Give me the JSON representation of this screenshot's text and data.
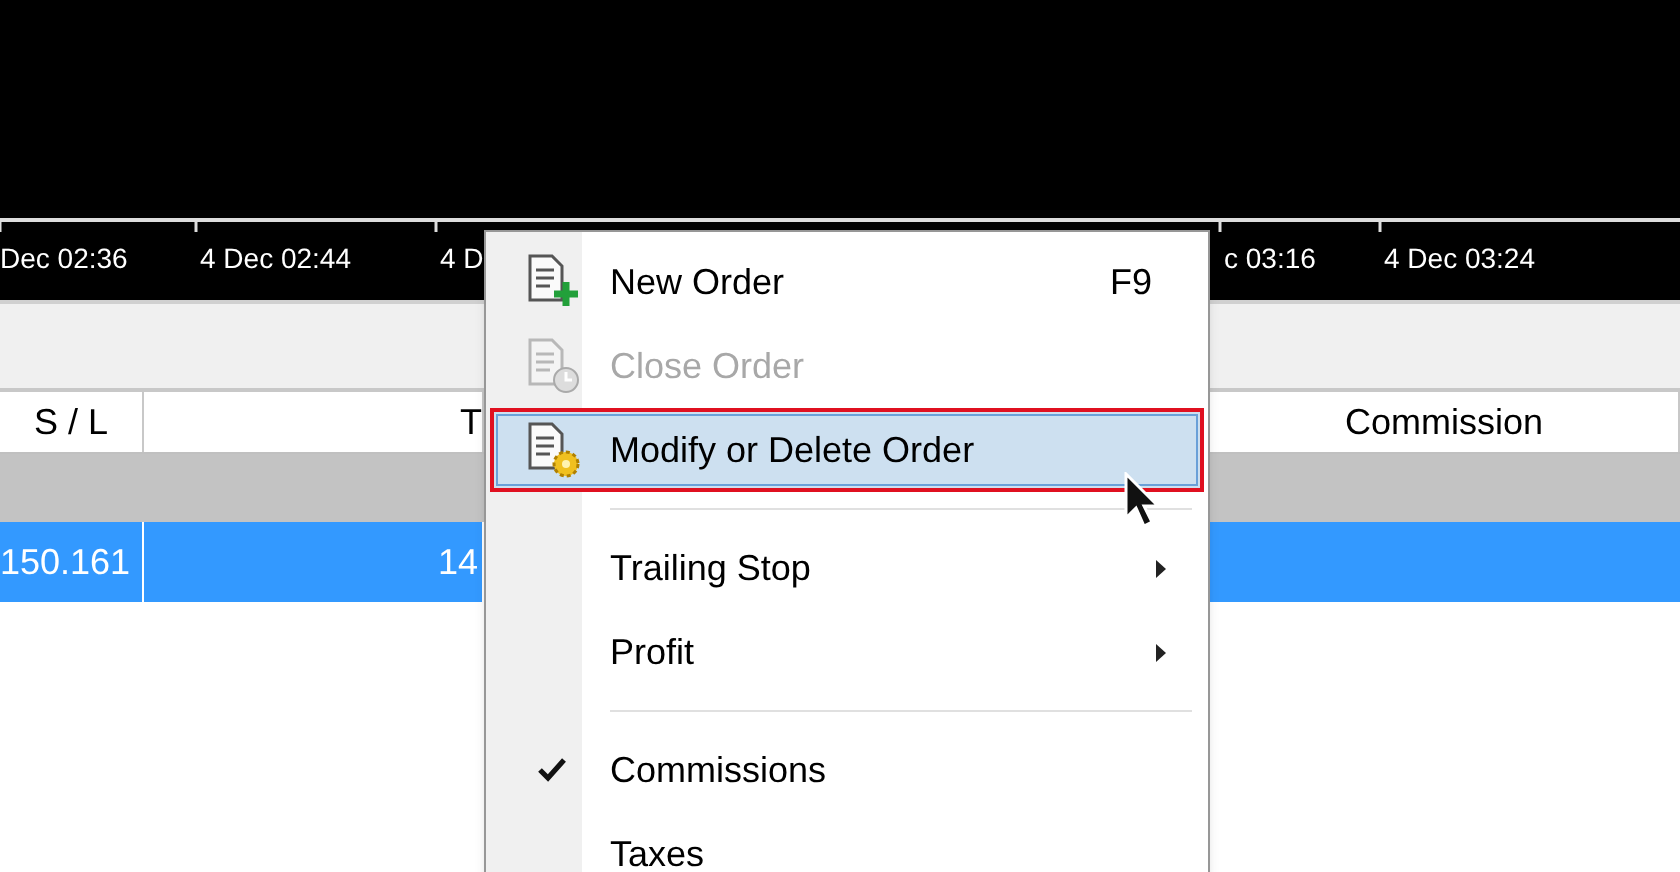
{
  "timeline": {
    "labels": [
      "Dec 02:36",
      "4 Dec 02:44",
      "4 D",
      "c 03:16",
      "4 Dec 03:24"
    ]
  },
  "table": {
    "columns": [
      "S / L",
      "T",
      "",
      "Commission"
    ],
    "rows": [
      {
        "kind": "group",
        "selected": false,
        "cells": []
      },
      {
        "kind": "order",
        "selected": true,
        "cells": [
          "150.161",
          "14"
        ]
      }
    ]
  },
  "context_menu": {
    "items": [
      {
        "kind": "item",
        "label": "New Order",
        "shortcut": "F9",
        "disabled": false,
        "selected": false,
        "checked": false,
        "submenu": false
      },
      {
        "kind": "item",
        "label": "Close Order",
        "disabled": true,
        "selected": false,
        "checked": false,
        "submenu": false
      },
      {
        "kind": "item",
        "label": "Modify or Delete Order",
        "disabled": false,
        "selected": true,
        "checked": false,
        "submenu": false
      },
      {
        "kind": "separator"
      },
      {
        "kind": "item",
        "label": "Trailing Stop",
        "disabled": false,
        "selected": false,
        "checked": false,
        "submenu": true
      },
      {
        "kind": "item",
        "label": "Profit",
        "disabled": false,
        "selected": false,
        "checked": false,
        "submenu": true
      },
      {
        "kind": "separator"
      },
      {
        "kind": "item",
        "label": "Commissions",
        "disabled": false,
        "selected": false,
        "checked": true,
        "submenu": false
      },
      {
        "kind": "item",
        "label": "Taxes",
        "disabled": false,
        "selected": false,
        "checked": false,
        "submenu": false
      }
    ]
  }
}
